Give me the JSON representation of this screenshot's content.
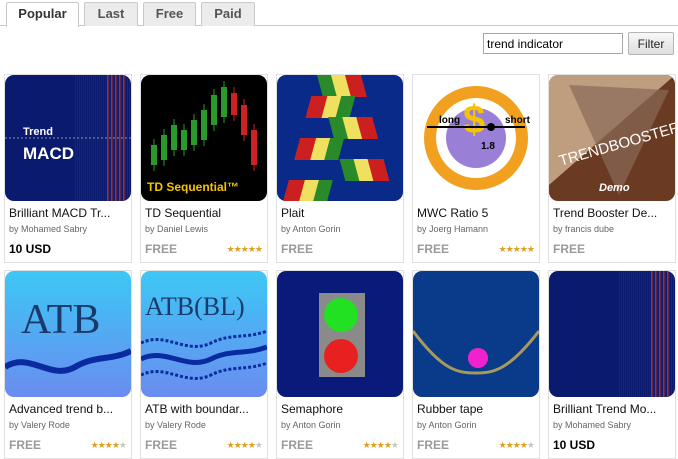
{
  "tabs": [
    {
      "label": "Popular",
      "active": true
    },
    {
      "label": "Last",
      "active": false
    },
    {
      "label": "Free",
      "active": false
    },
    {
      "label": "Paid",
      "active": false
    }
  ],
  "search": {
    "value": "trend indicator",
    "button_label": "Filter"
  },
  "products": [
    {
      "title": "Brilliant MACD Tr...",
      "author": "by Mohamed Sabry",
      "price": "10 USD",
      "paid": true,
      "rating": 0,
      "thumb": {
        "kind": "dark-lines",
        "line1": "Trend",
        "line2": "MACD"
      }
    },
    {
      "title": "TD Sequential",
      "author": "by Daniel Lewis",
      "price": "FREE",
      "paid": false,
      "rating": 5,
      "thumb": {
        "kind": "td",
        "text": "TD Sequential™"
      }
    },
    {
      "title": "Plait",
      "author": "by Anton Gorin",
      "price": "FREE",
      "paid": false,
      "rating": 0,
      "thumb": {
        "kind": "plait"
      }
    },
    {
      "title": "MWC Ratio 5",
      "author": "by Joerg Hamann",
      "price": "FREE",
      "paid": false,
      "rating": 5,
      "thumb": {
        "kind": "mwc",
        "left": "long",
        "right": "short",
        "value": "1.8"
      }
    },
    {
      "title": "Trend Booster De...",
      "author": "by francis dube",
      "price": "FREE",
      "paid": false,
      "rating": 0,
      "thumb": {
        "kind": "booster",
        "text": "TRENDBOOSTER",
        "sub": "Demo"
      }
    },
    {
      "title": "Advanced trend b...",
      "author": "by Valery Rode",
      "price": "FREE",
      "paid": false,
      "rating": 4,
      "thumb": {
        "kind": "atb",
        "text": "ATB"
      }
    },
    {
      "title": "ATB with boundar...",
      "author": "by Valery Rode",
      "price": "FREE",
      "paid": false,
      "rating": 4,
      "thumb": {
        "kind": "atbbl",
        "text": "ATB(BL)"
      }
    },
    {
      "title": "Semaphore",
      "author": "by Anton Gorin",
      "price": "FREE",
      "paid": false,
      "rating": 4,
      "thumb": {
        "kind": "semaphore"
      }
    },
    {
      "title": "Rubber tape",
      "author": "by Anton Gorin",
      "price": "FREE",
      "paid": false,
      "rating": 4,
      "thumb": {
        "kind": "rubber"
      }
    },
    {
      "title": "Brilliant Trend Mo...",
      "author": "by Mohamed Sabry",
      "price": "10 USD",
      "paid": true,
      "rating": 0,
      "thumb": {
        "kind": "dark-lines-plain"
      }
    }
  ],
  "colors": {
    "accent_blue": "#1f4fa8",
    "star": "#e0a020"
  }
}
